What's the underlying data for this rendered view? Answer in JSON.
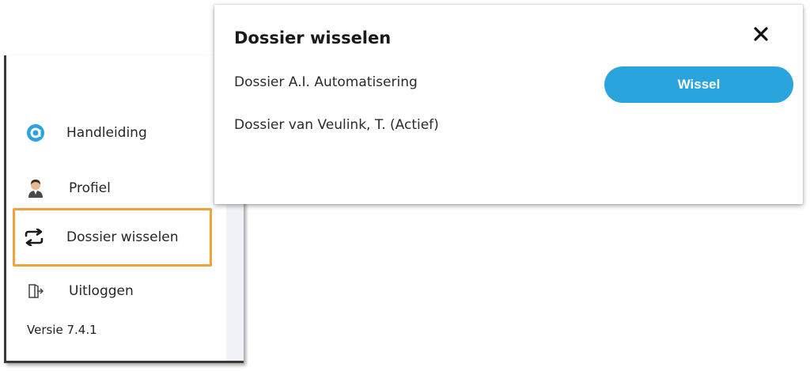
{
  "sidebar": {
    "items": [
      {
        "label": "Handleiding",
        "icon": "help-circle-icon"
      },
      {
        "label": "Profiel",
        "icon": "user-avatar-icon"
      },
      {
        "label": "Dossier wisselen",
        "icon": "switch-arrows-icon"
      },
      {
        "label": "Uitloggen",
        "icon": "logout-door-icon"
      }
    ],
    "version": "Versie 7.4.1"
  },
  "modal": {
    "title": "Dossier wisselen",
    "close_icon": "close-icon",
    "dossiers": [
      {
        "name": "Dossier A.I. Automatisering",
        "action_label": "Wissel"
      },
      {
        "name": "Dossier van Veulink, T. (Actief)"
      }
    ]
  },
  "colors": {
    "accent": "#2aa4dd",
    "highlight": "#f0a338",
    "text": "#2b2b2b"
  }
}
